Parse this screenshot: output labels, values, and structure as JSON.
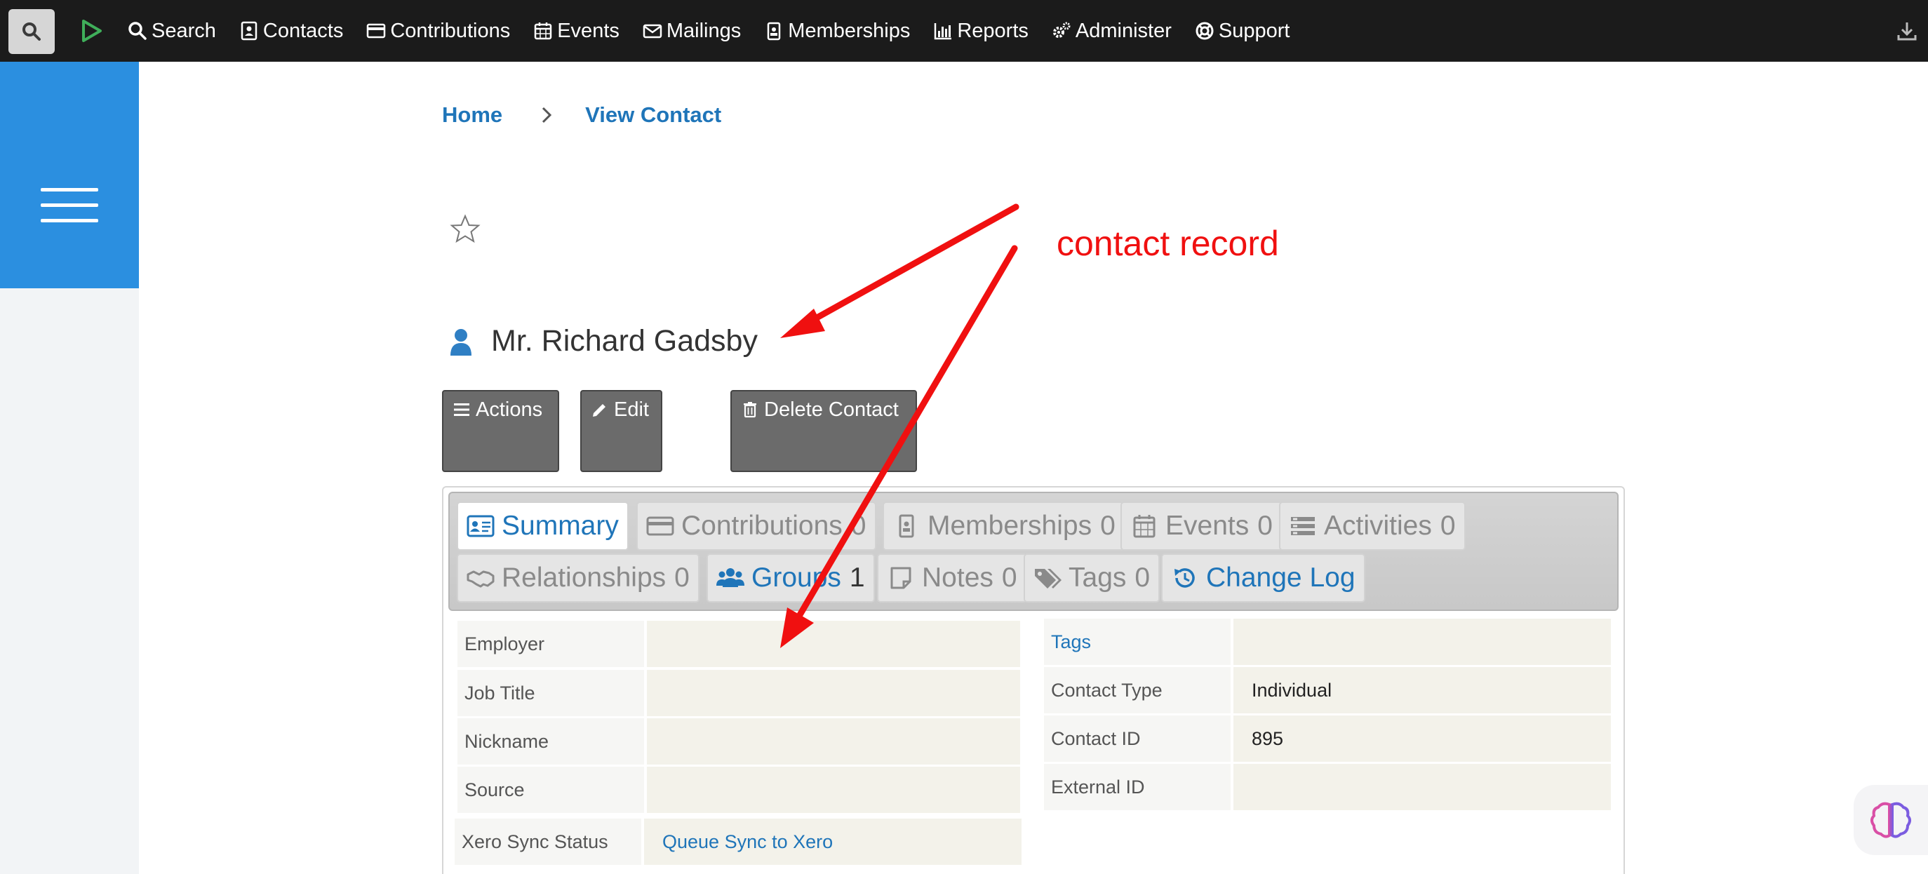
{
  "nav": {
    "items": [
      {
        "label": "Search",
        "icon": "search-icon"
      },
      {
        "label": "Contacts",
        "icon": "contact-card-icon"
      },
      {
        "label": "Contributions",
        "icon": "credit-card-icon"
      },
      {
        "label": "Events",
        "icon": "calendar-icon"
      },
      {
        "label": "Mailings",
        "icon": "envelope-icon"
      },
      {
        "label": "Memberships",
        "icon": "id-badge-icon"
      },
      {
        "label": "Reports",
        "icon": "bar-chart-icon"
      },
      {
        "label": "Administer",
        "icon": "gears-icon"
      },
      {
        "label": "Support",
        "icon": "life-ring-icon"
      }
    ]
  },
  "breadcrumb": {
    "home": "Home",
    "current": "View Contact"
  },
  "contact": {
    "name": "Mr. Richard Gadsby"
  },
  "buttons": {
    "actions": "Actions",
    "edit": "Edit",
    "delete": "Delete Contact"
  },
  "tabs": [
    {
      "label": "Summary",
      "count": ""
    },
    {
      "label": "Contributions",
      "count": "0"
    },
    {
      "label": "Memberships",
      "count": "0"
    },
    {
      "label": "Events",
      "count": "0"
    },
    {
      "label": "Activities",
      "count": "0"
    },
    {
      "label": "Relationships",
      "count": "0"
    },
    {
      "label": "Groups",
      "count": "1"
    },
    {
      "label": "Notes",
      "count": "0"
    },
    {
      "label": "Tags",
      "count": "0"
    },
    {
      "label": "Change Log",
      "count": ""
    }
  ],
  "left_fields": [
    {
      "label": "Employer",
      "value": ""
    },
    {
      "label": "Job Title",
      "value": ""
    },
    {
      "label": "Nickname",
      "value": ""
    },
    {
      "label": "Source",
      "value": ""
    },
    {
      "label": "Xero Sync Status",
      "value": "Queue Sync to Xero"
    }
  ],
  "right_fields": [
    {
      "label": "Tags",
      "value": ""
    },
    {
      "label": "Contact Type",
      "value": "Individual"
    },
    {
      "label": "Contact ID",
      "value": "895"
    },
    {
      "label": "External ID",
      "value": ""
    }
  ],
  "annotation": {
    "text": "contact record"
  },
  "colors": {
    "accent": "#1f75b9",
    "drawer": "#2b8fe0",
    "navbar": "#1b1b1b",
    "annotation": "#f01010"
  }
}
